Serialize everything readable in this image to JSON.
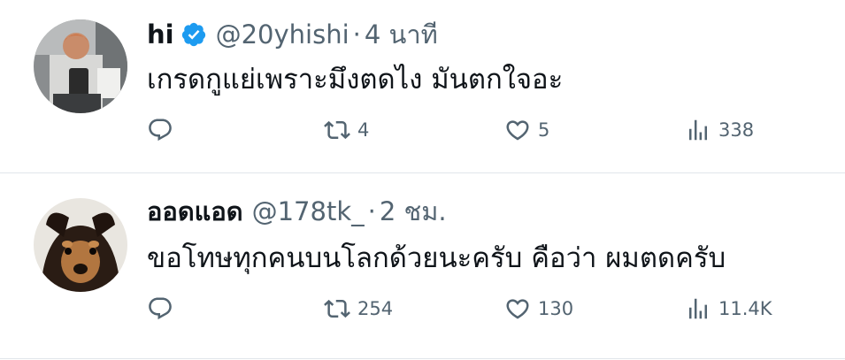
{
  "tweets": [
    {
      "display_name": "hi",
      "verified": true,
      "handle": "@20yhishi",
      "separator": "·",
      "time": "4 นาที",
      "text": "เกรดกูแย่เพราะมึงตดไง มันตกใจอะ",
      "reply_count": "",
      "retweet_count": "4",
      "like_count": "5",
      "view_count": "338",
      "avatar": "person-photo"
    },
    {
      "display_name": "ออดแอด",
      "verified": false,
      "handle": "@178tk_",
      "separator": "·",
      "time": "2 ชม.",
      "text": "ขอโทษทุกคนบนโลกด้วยนะครับ คือว่า ผมตดครับ",
      "reply_count": "",
      "retweet_count": "254",
      "like_count": "130",
      "view_count": "11.4K",
      "avatar": "dog-photo"
    }
  ],
  "colors": {
    "text": "#0f1419",
    "secondary": "#536471",
    "verified": "#1d9bf0",
    "divider": "#e1e6ea"
  },
  "icons": [
    "reply-icon",
    "retweet-icon",
    "like-icon",
    "views-icon",
    "verified-badge-icon"
  ]
}
